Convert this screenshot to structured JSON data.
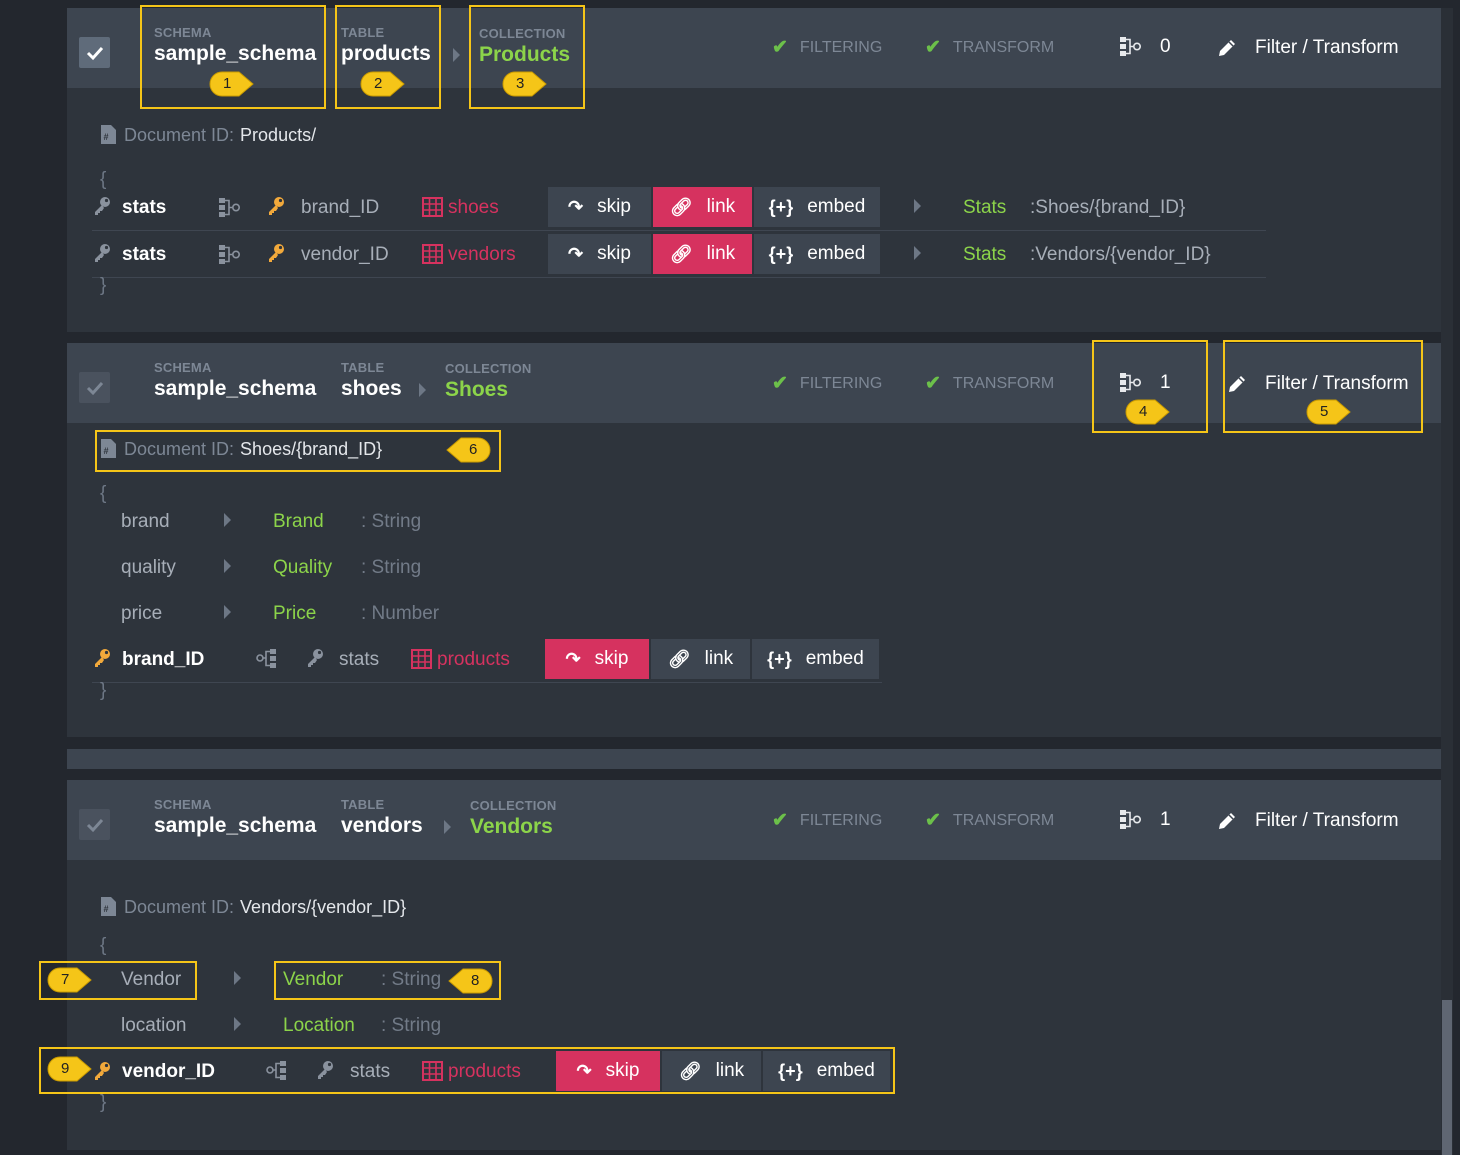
{
  "labels": {
    "schema": "SCHEMA",
    "table": "TABLE",
    "collection": "COLLECTION",
    "filtering": "FILTERING",
    "transform": "TRANSFORM",
    "filter_transform": "Filter / Transform",
    "doc_id": "Document ID:",
    "brace_open": "{",
    "brace_close": "}"
  },
  "buttons": {
    "skip": "skip",
    "link": "link",
    "embed": "embed"
  },
  "panel1": {
    "schema": "sample_schema",
    "table": "products",
    "collection": "Products",
    "count": "0",
    "doc_id": "Products/",
    "rows": [
      {
        "name": "stats",
        "field": "brand_ID",
        "table": "shoes",
        "target": "Stats",
        "path": ":Shoes/{brand_ID}"
      },
      {
        "name": "stats",
        "field": "vendor_ID",
        "table": "vendors",
        "target": "Stats",
        "path": ":Vendors/{vendor_ID}"
      }
    ]
  },
  "panel2": {
    "schema": "sample_schema",
    "table": "shoes",
    "collection": "Shoes",
    "count": "1",
    "doc_id": "Shoes/{brand_ID}",
    "fields": [
      {
        "name": "brand",
        "target": "Brand",
        "type": ": String"
      },
      {
        "name": "quality",
        "target": "Quality",
        "type": ": String"
      },
      {
        "name": "price",
        "target": "Price",
        "type": ": Number"
      }
    ],
    "rel": {
      "name": "brand_ID",
      "field": "stats",
      "table": "products"
    }
  },
  "panel3": {
    "schema": "sample_schema",
    "table": "vendors",
    "collection": "Vendors",
    "count": "1",
    "doc_id": "Vendors/{vendor_ID}",
    "fields": [
      {
        "name": "Vendor",
        "target": "Vendor",
        "type": ": String"
      },
      {
        "name": "location",
        "target": "Location",
        "type": ": String"
      }
    ],
    "rel": {
      "name": "vendor_ID",
      "field": "stats",
      "table": "products"
    }
  },
  "callouts": [
    "1",
    "2",
    "3",
    "4",
    "5",
    "6",
    "7",
    "8",
    "9"
  ],
  "colors": {
    "accent_red": "#d6325f",
    "accent_green": "#8cd44a",
    "callout_yellow": "#f5c518"
  }
}
